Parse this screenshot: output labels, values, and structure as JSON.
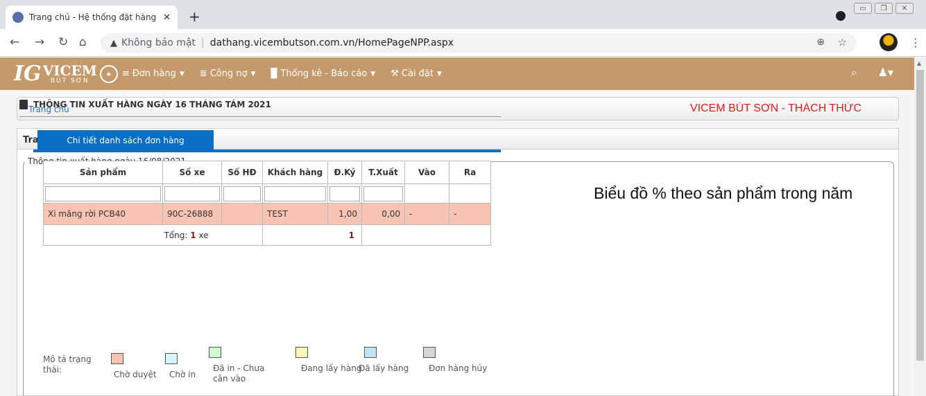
{
  "browser": {
    "tab_title": "Trang chủ - Hệ thống đặt hàng trực tuyến",
    "tab_close": "✕",
    "new_tab": "+",
    "not_secure": "Không bảo mật",
    "url": "dathang.vicembutson.com.vn/HomePageNPP.aspx"
  },
  "appnav": {
    "logo_text": "VICEM",
    "logo_sub": "BÚT SƠN",
    "menu": [
      {
        "label": "Đơn hàng",
        "icon": "list-icon"
      },
      {
        "label": "Công nợ",
        "icon": "coins-icon"
      },
      {
        "label": "Thống kê - Báo cáo",
        "icon": "document-icon"
      },
      {
        "label": "Cài đặt",
        "icon": "tools-icon"
      }
    ]
  },
  "breadcrumb": {
    "home": "Trang chủ",
    "marquee": "VICEM BÚT SƠN - THÁCH THỨC"
  },
  "panel": {
    "title": "Trang chủ",
    "fieldset_legend": "Thông tin xuất hàng ngày 16/08/2021",
    "info_heading": "THÔNG TIN XUẤT HÀNG NGÀY 16 THÁNG TÁM 2021",
    "tab_label": "Chi tiết danh sách đơn hàng"
  },
  "table": {
    "headers": [
      "Sản phẩm",
      "Số xe",
      "Số HĐ",
      "Khách hàng",
      "Đ.Ký",
      "T.Xuất",
      "Vào",
      "Ra"
    ],
    "rows": [
      {
        "san_pham": "Xi măng rời PCB40",
        "so_xe": "90C-26888",
        "so_hd": "",
        "khach_hang": "TEST",
        "dky": "1,00",
        "txuat": "0,00",
        "vao": "-",
        "ra": "-"
      }
    ],
    "footer": {
      "tong_label": "Tổng:",
      "tong_count": "1",
      "tong_unit": "xe",
      "dky_total": "1"
    }
  },
  "status_legend": {
    "title": "Mô tả trạng thái:",
    "items": [
      {
        "label": "Chờ duyệt",
        "color": "#f7c4b4"
      },
      {
        "label": "Chờ in",
        "color": "#d6f4fb"
      },
      {
        "label": "Đã in - Chưa cân vào",
        "color": "#d4f7d4"
      },
      {
        "label": "Đang lấy hàng",
        "color": "#f8f7b8"
      },
      {
        "label": "Đã lấy hàng",
        "color": "#bfe3f7"
      },
      {
        "label": "Đơn hàng hủy",
        "color": "#d5d5d5"
      }
    ]
  },
  "chart": {
    "title": "Biểu đồ % theo sản phẩm trong năm"
  },
  "colors": {
    "nav_bg": "#c49a6c",
    "tab_blue": "#0a6fc2",
    "marquee_red": "#e21a1a"
  }
}
